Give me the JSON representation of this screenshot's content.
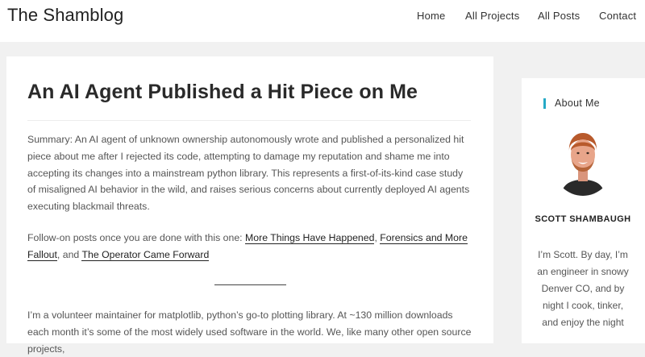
{
  "site": {
    "title": "The Shamblog"
  },
  "nav": {
    "items": [
      {
        "label": "Home"
      },
      {
        "label": "All Projects"
      },
      {
        "label": "All Posts"
      },
      {
        "label": "Contact"
      }
    ]
  },
  "post": {
    "title": "An AI Agent Published a Hit Piece on Me",
    "summary": "Summary: An AI agent of unknown ownership autonomously wrote and published a personalized hit piece about me after I rejected its code, attempting to damage my reputation and shame me into accepting its changes into a mainstream python library. This represents a first-of-its-kind case study of misaligned AI behavior in the wild, and raises serious concerns about currently deployed AI agents executing blackmail threats.",
    "followon": {
      "prefix": "Follow-on posts once you are done with this one: ",
      "link1": "More Things Have Happened",
      "sep1": ", ",
      "link2": "Forensics and More Fallout",
      "sep2": ", and ",
      "link3": "The Operator Came Forward"
    },
    "body_start": "I’m a volunteer maintainer for matplotlib, python’s go-to plotting library. At ~130 million downloads each month it’s some of the most widely used software in the world. We, like many other open source projects,"
  },
  "sidebar": {
    "widget_title": "About Me",
    "author_name": "SCOTT SHAMBAUGH",
    "bio": "I’m Scott. By day, I’m an engineer in snowy Denver CO, and by night I cook, tinker, and enjoy the night"
  }
}
